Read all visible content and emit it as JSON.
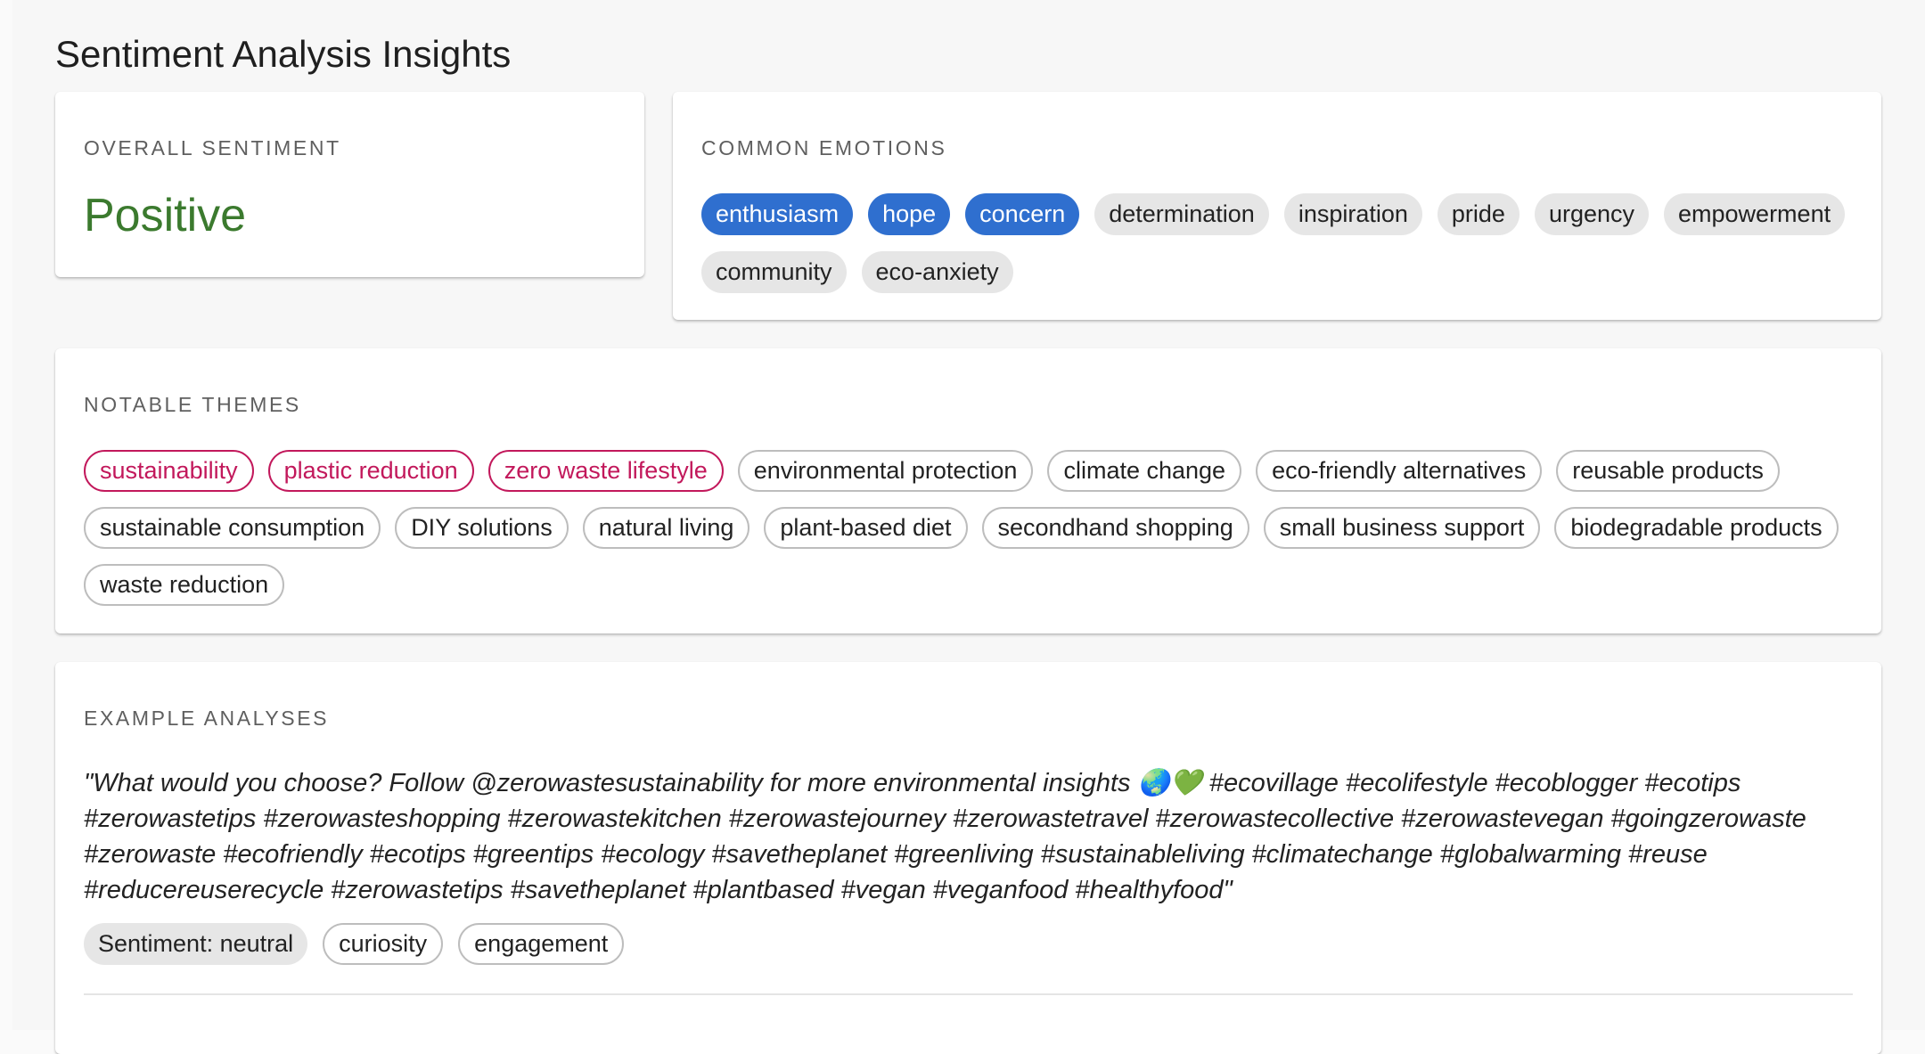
{
  "page": {
    "title": "Sentiment Analysis Insights"
  },
  "overall": {
    "label": "OVERALL SENTIMENT",
    "value": "Positive"
  },
  "emotions": {
    "label": "COMMON EMOTIONS",
    "items": [
      {
        "text": "enthusiasm",
        "style": "filled-primary"
      },
      {
        "text": "hope",
        "style": "filled-primary"
      },
      {
        "text": "concern",
        "style": "filled-primary"
      },
      {
        "text": "determination",
        "style": "filled-default"
      },
      {
        "text": "inspiration",
        "style": "filled-default"
      },
      {
        "text": "pride",
        "style": "filled-default"
      },
      {
        "text": "urgency",
        "style": "filled-default"
      },
      {
        "text": "empowerment",
        "style": "filled-default"
      },
      {
        "text": "community",
        "style": "filled-default"
      },
      {
        "text": "eco-anxiety",
        "style": "filled-default"
      }
    ]
  },
  "themes": {
    "label": "NOTABLE THEMES",
    "items": [
      {
        "text": "sustainability",
        "style": "outlined-secondary"
      },
      {
        "text": "plastic reduction",
        "style": "outlined-secondary"
      },
      {
        "text": "zero waste lifestyle",
        "style": "outlined-secondary"
      },
      {
        "text": "environmental protection",
        "style": "outlined-default"
      },
      {
        "text": "climate change",
        "style": "outlined-default"
      },
      {
        "text": "eco-friendly alternatives",
        "style": "outlined-default"
      },
      {
        "text": "reusable products",
        "style": "outlined-default"
      },
      {
        "text": "sustainable consumption",
        "style": "outlined-default"
      },
      {
        "text": "DIY solutions",
        "style": "outlined-default"
      },
      {
        "text": "natural living",
        "style": "outlined-default"
      },
      {
        "text": "plant-based diet",
        "style": "outlined-default"
      },
      {
        "text": "secondhand shopping",
        "style": "outlined-default"
      },
      {
        "text": "small business support",
        "style": "outlined-default"
      },
      {
        "text": "biodegradable products",
        "style": "outlined-default"
      },
      {
        "text": "waste reduction",
        "style": "outlined-default"
      }
    ]
  },
  "examples": {
    "label": "EXAMPLE ANALYSES",
    "items": [
      {
        "text": "\"What would you choose? Follow @zerowastesustainability for more environmental insights 🌏💚 #ecovillage #ecolifestyle #ecoblogger #ecotips #zerowastetips #zerowasteshopping #zerowastekitchen #zerowastejourney #zerowastetravel #zerowastecollective #zerowastevegan #goingzerowaste #zerowaste #ecofriendly #ecotips #greentips #ecology #savetheplanet #greenliving #sustainableliving #climatechange #globalwarming #reuse #reducereuserecycle #zerowastetips #savetheplanet #plantbased #vegan #veganfood #healthyfood\"",
        "sentiment": "Sentiment: neutral",
        "tags": [
          "curiosity",
          "engagement"
        ]
      }
    ]
  },
  "colors": {
    "positive": "#3b7a2e",
    "primary_chip": "#2f6fcf",
    "secondary_chip": "#c2185b",
    "default_chip": "#e6e6e6"
  }
}
